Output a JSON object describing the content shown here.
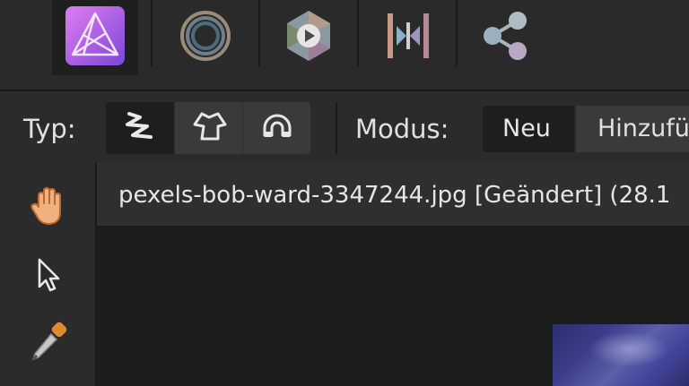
{
  "personas": [
    {
      "name": "Photo Persona",
      "icon": "affinity-photo-icon",
      "active": true
    },
    {
      "name": "Liquify Persona",
      "icon": "liquify-persona-icon",
      "active": false
    },
    {
      "name": "Develop Persona",
      "icon": "develop-persona-icon",
      "active": false
    },
    {
      "name": "Tone Mapping Persona",
      "icon": "tone-mapping-persona-icon",
      "active": false
    },
    {
      "name": "Export Persona",
      "icon": "export-persona-icon",
      "active": false
    }
  ],
  "context_toolbar": {
    "type_label": "Typ:",
    "type_options": [
      {
        "icon": "freehand-selection-icon",
        "active": true
      },
      {
        "icon": "polygonal-selection-icon",
        "active": false
      },
      {
        "icon": "magnetic-selection-icon",
        "active": false
      }
    ],
    "mode_label": "Modus:",
    "mode_options": [
      "Neu",
      "Hinzufü"
    ]
  },
  "tools": [
    {
      "icon": "hand-tool-icon"
    },
    {
      "icon": "move-tool-icon"
    },
    {
      "icon": "color-picker-tool-icon"
    }
  ],
  "document": {
    "tab_title": "pexels-bob-ward-3347244.jpg [Geändert] (28.1"
  },
  "colors": {
    "accent": "#9b5de5",
    "background": "#1e1e1e",
    "panel": "#2b2b2b"
  }
}
